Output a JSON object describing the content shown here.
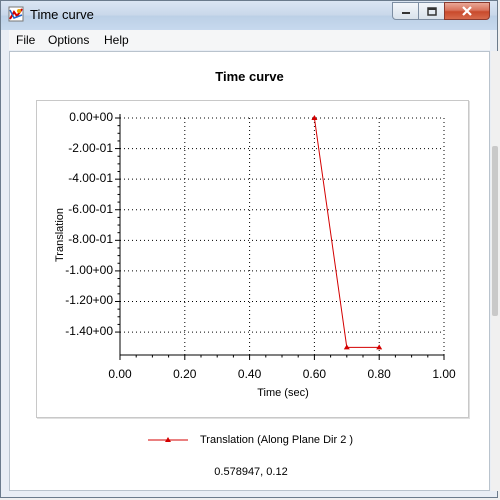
{
  "window": {
    "title": "Time curve",
    "icon": "app-icon",
    "controls": {
      "minimize": "minimize-icon",
      "maximize": "maximize-icon",
      "close": "close-icon"
    }
  },
  "menu": {
    "items": [
      "File",
      "Options",
      "Help"
    ]
  },
  "colors": {
    "series": "#d40000",
    "grid": "#000000"
  },
  "chart_data": {
    "type": "line",
    "title": "Time curve",
    "xlabel": "Time (sec)",
    "ylabel": "Translation",
    "xlim": [
      0,
      1
    ],
    "ylim": [
      -1.55,
      0
    ],
    "x_ticks": [
      "0.00",
      "0.20",
      "0.40",
      "0.60",
      "0.80",
      "1.00"
    ],
    "y_ticks": [
      "0.00+00",
      "-2.00-01",
      "-4.00-01",
      "-6.00-01",
      "-8.00-01",
      "-1.00+00",
      "-1.20+00",
      "-1.40+00"
    ],
    "grid": true,
    "legend_position": "bottom-center",
    "series": [
      {
        "name": "Translation (Along Plane Dir 2 )",
        "x": [
          0.6,
          0.7,
          0.8
        ],
        "y": [
          0,
          -1.5,
          -1.5
        ]
      }
    ]
  },
  "status": {
    "coordinates": "0.578947, 0.12"
  }
}
